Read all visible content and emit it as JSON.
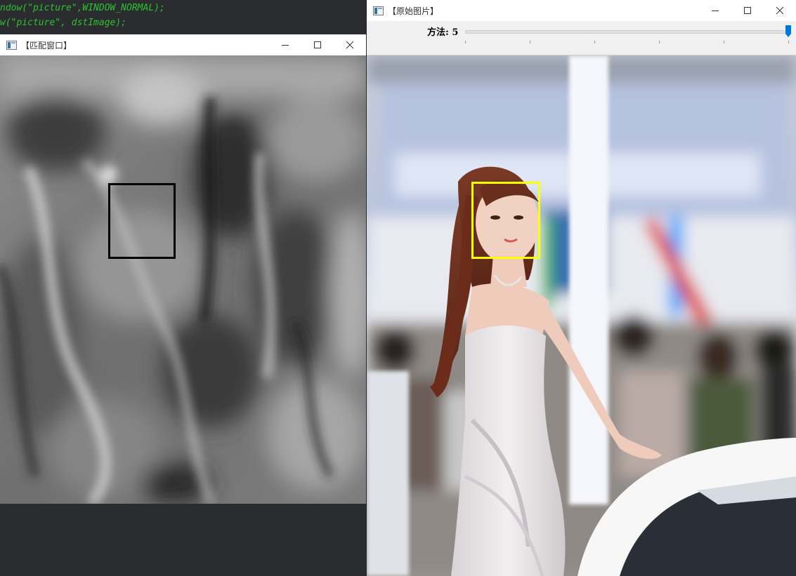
{
  "editor": {
    "lines": [
      "ndow(\"picture\",WINDOW_NORMAL);",
      "w(\"picture\", dstImage);"
    ]
  },
  "match_window": {
    "title": "【匹配窗口】"
  },
  "original_window": {
    "title": "【原始图片】",
    "trackbar": {
      "label": "方法: 5",
      "value": 5,
      "max": 5
    }
  },
  "colors": {
    "editor_bg": "#2b2c30",
    "code_text": "#2ec12e",
    "match_rect": "#000000",
    "face_rect": "#ffff00",
    "slider_thumb": "#0078d7"
  },
  "icons": {
    "minimize": "minimize-icon",
    "maximize": "maximize-icon",
    "close": "close-icon"
  }
}
